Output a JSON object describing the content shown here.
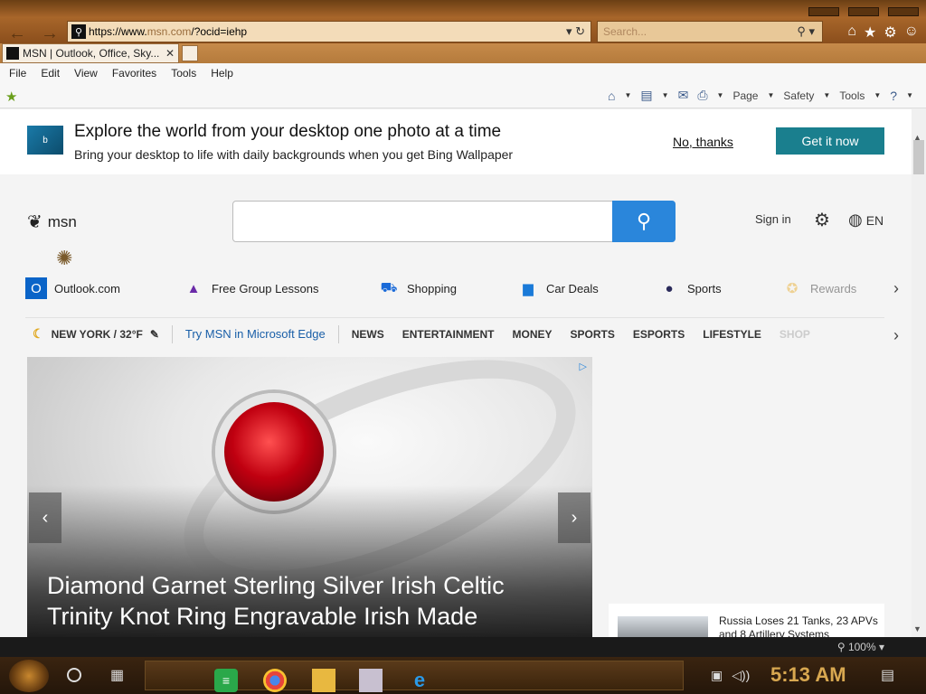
{
  "browser": {
    "url_prefix": "https://www.",
    "url_host": "msn.com",
    "url_suffix": "/?ocid=iehp",
    "search_placeholder": "Search...",
    "tab_title": "MSN | Outlook, Office, Sky...",
    "menu": [
      "File",
      "Edit",
      "View",
      "Favorites",
      "Tools",
      "Help"
    ],
    "cmd": {
      "page": "Page",
      "safety": "Safety",
      "tools": "Tools"
    }
  },
  "promo": {
    "title": "Explore the world from your desktop one photo at a time",
    "subtitle": "Bring your desktop to life with daily backgrounds when you get Bing Wallpaper",
    "no_thanks": "No, thanks",
    "get_it": "Get it now"
  },
  "msn": {
    "logo_text": "msn",
    "sign_in": "Sign in",
    "language": "EN"
  },
  "quicklinks": [
    {
      "label": "Outlook.com",
      "icon": "outlook-icon",
      "color": "#0a64c8"
    },
    {
      "label": "Free Group Lessons",
      "icon": "graduation-cap-icon",
      "color": "#6a2aa8"
    },
    {
      "label": "Shopping",
      "icon": "cart-icon",
      "color": "#1a6ad8"
    },
    {
      "label": "Car Deals",
      "icon": "car-icon",
      "color": "#1a7ad8"
    },
    {
      "label": "Sports",
      "icon": "soccer-ball-icon",
      "color": "#2a2a5a"
    },
    {
      "label": "Rewards",
      "icon": "medal-icon",
      "color": "#e8a820"
    }
  ],
  "navrow": {
    "weather": "NEW YORK / 32°F",
    "try_edge": "Try MSN in Microsoft Edge",
    "items": [
      "NEWS",
      "ENTERTAINMENT",
      "MONEY",
      "SPORTS",
      "ESPORTS",
      "LIFESTYLE",
      "SHOP"
    ]
  },
  "hero": {
    "headline": "Diamond Garnet Sterling Silver Irish Celtic Trinity Knot Ring Engravable Irish Made"
  },
  "side_story": {
    "headline": "Russia Loses 21 Tanks, 23 APVs and 8 Artillery Systems"
  },
  "status": {
    "zoom": "100%"
  },
  "taskbar": {
    "clock": "5:13 AM"
  },
  "colors": {
    "accent": "#2a86db",
    "promo_button": "#1a7f8e",
    "wood": "#a8662a"
  }
}
